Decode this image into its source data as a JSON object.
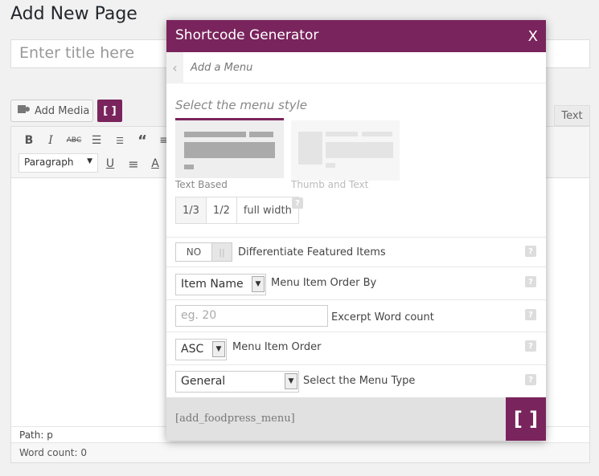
{
  "page": {
    "title": "Add New Page",
    "title_placeholder": "Enter title here"
  },
  "editor": {
    "add_media_label": "Add Media",
    "shortcode_button_label": "[ ]",
    "text_tab_label": "Text",
    "format_select_value": "Paragraph",
    "path_text": "Path: p",
    "word_count_text": "Word count: 0"
  },
  "modal": {
    "title": "Shortcode Generator",
    "close_label": "X",
    "back_icon": "chevron-left-icon",
    "subheader": "Add a Menu",
    "style_heading": "Select the menu style",
    "style_options": [
      {
        "label": "Text Based",
        "selected": true
      },
      {
        "label": "Thumb and Text",
        "selected": false
      }
    ],
    "width_options": [
      {
        "label": "1/3",
        "active": true
      },
      {
        "label": "1/2",
        "active": false
      },
      {
        "label": "full width",
        "active": false
      }
    ],
    "help_label": "?",
    "fields": {
      "featured": {
        "toggle_value": "NO",
        "knob_label": "||",
        "label": "Differentiate Featured Items"
      },
      "order_by": {
        "value": "Item Name",
        "label": "Menu Item Order By"
      },
      "excerpt": {
        "placeholder": "eg. 20",
        "label": "Excerpt Word count"
      },
      "order": {
        "value": "ASC",
        "label": "Menu Item Order"
      },
      "menu_type": {
        "value": "General",
        "label": "Select the Menu Type"
      }
    },
    "shortcode_output": "[add_foodpress_menu]",
    "insert_button_label": "[ ]"
  },
  "colors": {
    "accent": "#7a245d"
  }
}
